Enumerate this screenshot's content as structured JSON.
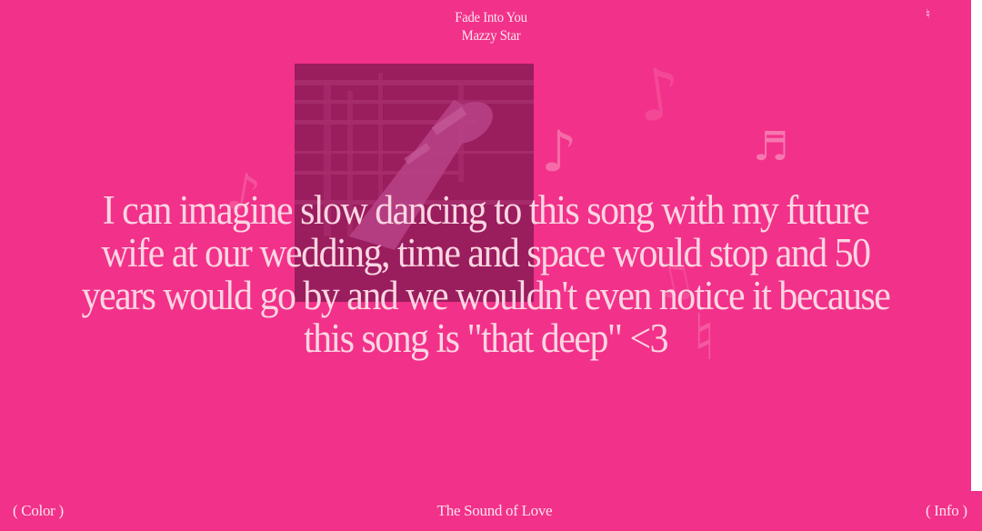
{
  "now_playing": {
    "title": "Fade Into You",
    "artist": "Mazzy Star"
  },
  "corner_icon": "music-note-icon",
  "album_art": {
    "icon": "album-cover-image",
    "tint": "#9e1f60"
  },
  "comment": {
    "text": "I can imagine slow dancing to this song with my future wife at our wedding, time and space would stop and 50 years would go by and we wouldn't even notice it because this song is \"that deep\" <3"
  },
  "footer": {
    "color_label": "( Color )",
    "site_title": "The Sound of Love",
    "info_label": "( Info )"
  },
  "colors": {
    "background": "#f2318a",
    "text": "#fbd6e2",
    "notes": "#fbb3d0"
  }
}
